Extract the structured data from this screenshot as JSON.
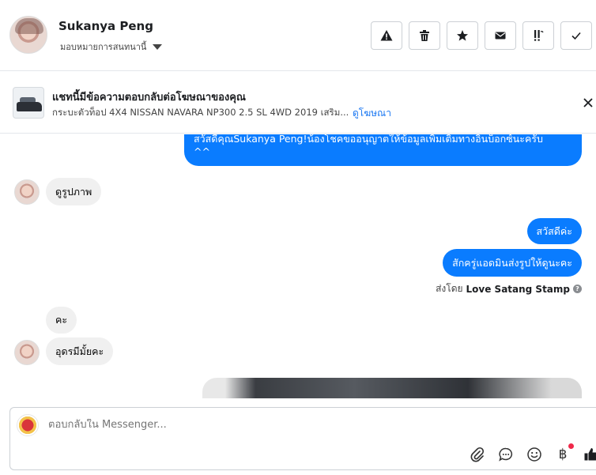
{
  "header": {
    "name": "Sukanya Peng",
    "subtitle": "มอบหมายการสนทนานี้",
    "actions": [
      "alert-icon",
      "trash-icon",
      "star-icon",
      "envelope-icon",
      "flag-icon",
      "check-icon"
    ]
  },
  "ad_banner": {
    "title": "แชทนี้มีข้อความตอบกลับต่อโฆษณาของคุณ",
    "description": "กระบะตัวท็อป 4X4 NISSAN NAVARA NP300 2.5 SL 4WD 2019 เสริม...",
    "link": "ดูโฆษณา"
  },
  "messages": {
    "out_1": "สวัสดีคุณSukanya Peng!น้องโชคขออนุญาตให้ข้อมูลเพิ่มเติมทางอินบ็อกซ์นะครับ",
    "out_1b": "^^",
    "in_1": "ดูรูปภาพ",
    "out_2": "สวัสดีค่ะ",
    "out_3": "สักครู่แอดมินส่งรูปให้ดูนะคะ",
    "sent_by_prefix": "ส่งโดย",
    "sent_by_name": "Love Satang Stamp",
    "in_2": "คะ",
    "in_3": "อุดรมีมั้ยคะ"
  },
  "composer": {
    "placeholder": "ตอบกลับใน Messenger...",
    "baht_symbol": "฿"
  },
  "colors": {
    "outgoing_bubble": "#0a7cff",
    "incoming_bubble": "#f0f0f0",
    "link": "#1876f2",
    "notification_dot": "#f02849"
  }
}
